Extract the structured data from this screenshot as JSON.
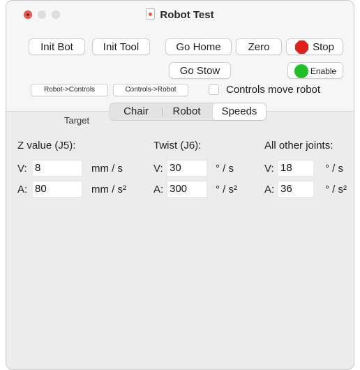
{
  "window": {
    "title": "Robot Test"
  },
  "toolbar": {
    "init_bot": "Init Bot",
    "init_tool": "Init Tool",
    "go_home": "Go Home",
    "zero": "Zero",
    "stop": "Stop",
    "go_stow": "Go Stow",
    "enable": "Enable",
    "robot_to_controls": "Robot->Controls",
    "controls_to_robot": "Controls->Robot",
    "controls_move_robot": "Controls move robot",
    "controls_move_robot_checked": false
  },
  "target": {
    "label": "Target",
    "tabs": [
      {
        "label": "Chair",
        "selected": false
      },
      {
        "label": "Robot",
        "selected": false
      },
      {
        "label": "Speeds",
        "selected": true
      }
    ]
  },
  "speeds": {
    "z": {
      "heading": "Z value (J5):",
      "v_label": "V:",
      "v_value": "8",
      "v_unit": "mm / s",
      "a_label": "A:",
      "a_value": "80",
      "a_unit": "mm / s²"
    },
    "twist": {
      "heading": "Twist (J6):",
      "v_label": "V:",
      "v_value": "30",
      "v_unit": "° / s",
      "a_label": "A:",
      "a_value": "300",
      "a_unit": "° / s²"
    },
    "other": {
      "heading": "All other joints:",
      "v_label": "V:",
      "v_value": "18",
      "v_unit": "° / s",
      "a_label": "A:",
      "a_value": "36",
      "a_unit": "° / s²"
    }
  },
  "icons": {
    "stop": "stop-sign-icon",
    "enable": "green-circle-icon",
    "title_doc": "document-icon"
  },
  "colors": {
    "stop_red": "#e0201b",
    "enable_green": "#22c028",
    "close_red": "#ee5e57"
  }
}
